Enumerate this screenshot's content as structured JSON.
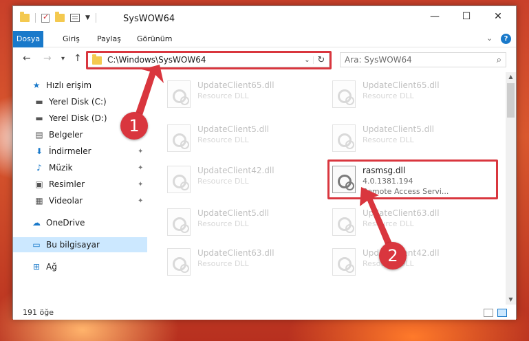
{
  "window": {
    "title": "SysWOW64",
    "controls": {
      "minimize": "—",
      "maximize": "☐",
      "close": "✕"
    }
  },
  "ribbon": {
    "tabs": [
      "Dosya",
      "Giriş",
      "Paylaş",
      "Görünüm"
    ],
    "active_tab": "Dosya",
    "help": "?"
  },
  "navigation": {
    "back": "←",
    "forward": "→",
    "recent": "▾",
    "up": "↑",
    "address": "C:\\Windows\\SysWOW64",
    "address_dropdown": "⌄",
    "refresh": "↻",
    "search_placeholder": "Ara: SysWOW64",
    "search_icon": "⌕"
  },
  "sidebar": {
    "items": [
      {
        "label": "Hızlı erişim",
        "icon": "star-icon",
        "glyph": "★",
        "color": "#1979ca"
      },
      {
        "label": "Yerel Disk (C:)",
        "icon": "drive-icon",
        "glyph": "▬",
        "pinned": true
      },
      {
        "label": "Yerel Disk (D:)",
        "icon": "drive-icon",
        "glyph": "▬",
        "pinned": true
      },
      {
        "label": "Belgeler",
        "icon": "documents-icon",
        "glyph": "▤",
        "pinned": true
      },
      {
        "label": "İndirmeler",
        "icon": "download-icon",
        "glyph": "⬇",
        "color": "#1979ca",
        "pinned": true
      },
      {
        "label": "Müzik",
        "icon": "music-icon",
        "glyph": "♪",
        "color": "#1979ca",
        "pinned": true
      },
      {
        "label": "Resimler",
        "icon": "pictures-icon",
        "glyph": "▣",
        "pinned": true
      },
      {
        "label": "Videolar",
        "icon": "video-icon",
        "glyph": "▦",
        "pinned": true
      },
      {
        "label": "OneDrive",
        "icon": "cloud-icon",
        "glyph": "☁",
        "color": "#1979ca"
      },
      {
        "label": "Bu bilgisayar",
        "icon": "computer-icon",
        "glyph": "▭",
        "color": "#1979ca",
        "selected": true
      },
      {
        "label": "Ağ",
        "icon": "network-icon",
        "glyph": "⊞",
        "color": "#1979ca"
      }
    ],
    "pin_glyph": "✦"
  },
  "files": [
    {
      "name": "UpdateClient65.dll",
      "desc": "Resource DLL",
      "dim": true
    },
    {
      "name": "UpdateClient65.dll",
      "desc": "Resource DLL",
      "dim": true
    },
    {
      "name": "UpdateClient5.dll",
      "desc": "Resource DLL",
      "dim": true
    },
    {
      "name": "UpdateClient5.dll",
      "desc": "Resource DLL",
      "dim": true
    },
    {
      "name": "UpdateClient42.dll",
      "desc": "Resource DLL",
      "dim": true
    },
    {
      "name": "rasmsg.dll",
      "version": "4.0.1381.194",
      "desc": "Remote Access Servi...",
      "dim": false
    },
    {
      "name": "UpdateClient5.dll",
      "desc": "Resource DLL",
      "dim": true
    },
    {
      "name": "UpdateClient63.dll",
      "desc": "Resource DLL",
      "dim": true
    },
    {
      "name": "UpdateClient63.dll",
      "desc": "Resource DLL",
      "dim": true
    },
    {
      "name": "UpdateClient42.dll",
      "desc": "Resource DLL",
      "dim": true
    }
  ],
  "status": {
    "count": "191 öğe"
  },
  "annotations": {
    "step1": "1",
    "step2": "2",
    "color": "#d9363e"
  }
}
